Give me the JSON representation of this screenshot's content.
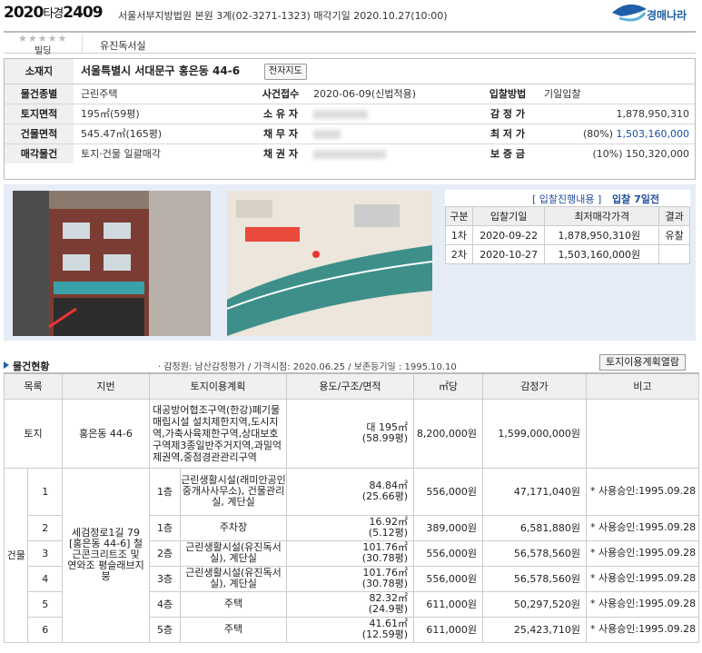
{
  "header": {
    "case_year": "2020",
    "case_type": "타경",
    "case_num": "2409",
    "case_info": "서울서부지방법원 본원 3계(02-3271-1323) 매각기일 2020.10.27(10:00)",
    "logo_text": "경매나라"
  },
  "type_bar": {
    "stars": "★★★★★",
    "type_label": "빌딩",
    "type_name": "유진독서실"
  },
  "summary": {
    "address_label": "소재지",
    "address": "서울특별시 서대문구 홍은동 44-6",
    "map_button": "전자지도",
    "rows": [
      {
        "l1": "물건종별",
        "v1": "근린주택",
        "l2": "사건접수",
        "v2": "2020-06-09(신법적용)",
        "l3": "입찰방법",
        "v3": "기일입찰"
      },
      {
        "l1": "토지면적",
        "v1": "195㎡(59평)",
        "l2": "소 유 자",
        "v2": "",
        "l3": "감 정 가",
        "v3": "1,878,950,310"
      },
      {
        "l1": "건물면적",
        "v1": "545.47㎡(165평)",
        "l2": "채 무 자",
        "v2": "",
        "l3": "최 저 가",
        "v3a": "(80%) ",
        "v3b": "1,503,160,000"
      },
      {
        "l1": "매각물건",
        "v1": "토지·건물 일괄매각",
        "l2": "채 권 자",
        "v2": "",
        "l3": "보 증 금",
        "v3": "(10%) 150,320,000"
      }
    ]
  },
  "bid_progress": {
    "title": "[ 입찰진행내용 ]",
    "title2": "입찰 7일전",
    "headers": [
      "구분",
      "입찰기일",
      "최저매각가격",
      "결과"
    ],
    "rows": [
      [
        "1차",
        "2020-09-22",
        "1,878,950,310원",
        "유찰"
      ],
      [
        "2차",
        "2020-10-27",
        "1,503,160,000원",
        ""
      ]
    ]
  },
  "status": {
    "title": "물건현황",
    "info": "· 감정원: 남산감정평가 / 가격시점: 2020.06.25 / 보존등기일 : 1995.10.10",
    "button": "토지이용계획열람"
  },
  "grid": {
    "headers": [
      "목록",
      "지번",
      "토지이용계획",
      "용도/구조/면적",
      "㎡당",
      "감정가",
      "비고"
    ],
    "land": {
      "cat": "토지",
      "jibun": "홍은동 44-6",
      "plan": "대공방어협조구역(한강)폐기물매립시설 설치제한지역,도시지역,가축사육제한구역,상대보호구역제3종일반주거지역,과밀억제권역,중점경관관리구역",
      "use1": "대 195㎡",
      "use2": "(58.99평)",
      "per": "8,200,000원",
      "price": "1,599,000,000원",
      "note": ""
    },
    "bldg_cat": "건물",
    "bldg_jibun": "세검정로1길 79 [홍은동 44-6] 철근콘크리트조 및 연와조 평슬래브지붕",
    "bldg": [
      {
        "no": "1",
        "floor": "1층",
        "use": "근린생활시설(래미안공인중개사사무소), 건물관리실, 계단실",
        "area1": "84.84㎡",
        "area2": "(25.66평)",
        "per": "556,000원",
        "price": "47,171,040원",
        "note": "* 사용승인:1995.09.28"
      },
      {
        "no": "2",
        "floor": "1층",
        "use": "주차장",
        "area1": "16.92㎡",
        "area2": "(5.12평)",
        "per": "389,000원",
        "price": "6,581,880원",
        "note": "* 사용승인:1995.09.28"
      },
      {
        "no": "3",
        "floor": "2층",
        "use": "근린생활시설(유진독서실), 계단실",
        "area1": "101.76㎡",
        "area2": "(30.78평)",
        "per": "556,000원",
        "price": "56,578,560원",
        "note": "* 사용승인:1995.09.28"
      },
      {
        "no": "4",
        "floor": "3층",
        "use": "근린생활시설(유진독서실), 계단실",
        "area1": "101.76㎡",
        "area2": "(30.78평)",
        "per": "556,000원",
        "price": "56,578,560원",
        "note": "* 사용승인:1995.09.28"
      },
      {
        "no": "5",
        "floor": "4층",
        "use": "주택",
        "area1": "82.32㎡",
        "area2": "(24.9평)",
        "per": "611,000원",
        "price": "50,297,520원",
        "note": "* 사용승인:1995.09.28"
      },
      {
        "no": "6",
        "floor": "5층",
        "use": "주택",
        "area1": "41.61㎡",
        "area2": "(12.59평)",
        "per": "611,000원",
        "price": "25,423,710원",
        "note": "* 사용승인:1995.09.28"
      }
    ]
  },
  "colors": {
    "accent": "#1f5fa8",
    "label_bg": "#f0f0f0",
    "photo_bg": "#e6edf6"
  }
}
